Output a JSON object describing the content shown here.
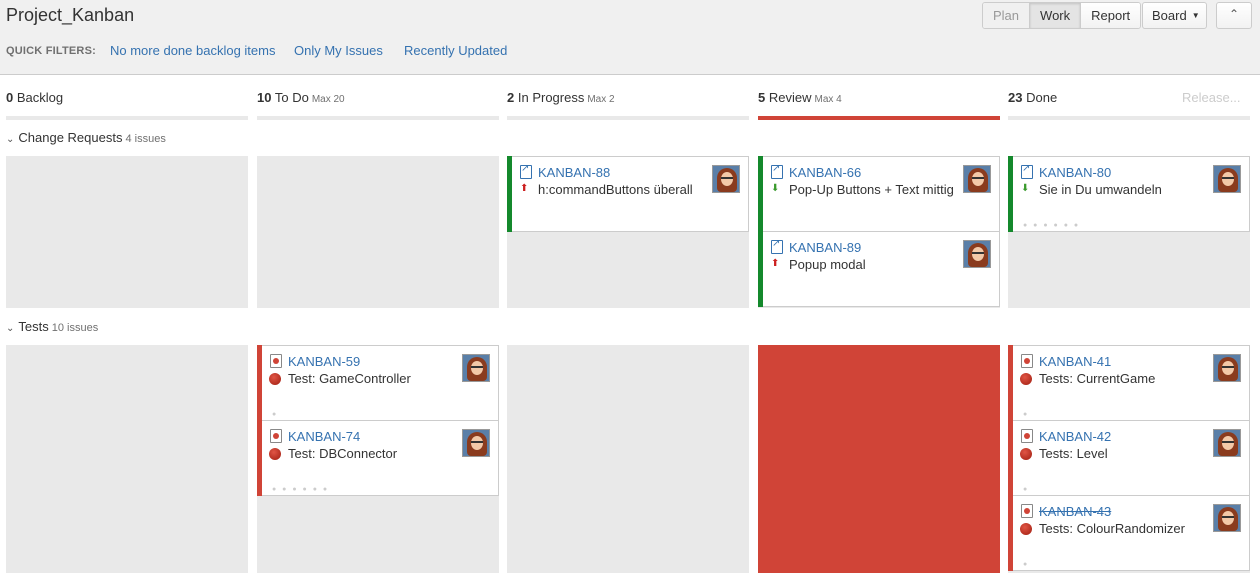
{
  "title": "Project_Kanban",
  "quick_filters": {
    "label": "QUICK FILTERS:",
    "items": [
      "No more done backlog items",
      "Only My Issues",
      "Recently Updated"
    ]
  },
  "modes": [
    "Plan",
    "Work",
    "Report"
  ],
  "board_button": "Board",
  "collapse_icon": "collapse-icon",
  "release_link": "Release...",
  "columns": [
    {
      "count": "0",
      "name": "Backlog",
      "max": ""
    },
    {
      "count": "10",
      "name": "To Do",
      "max": "Max 20"
    },
    {
      "count": "2",
      "name": "In Progress",
      "max": "Max 2"
    },
    {
      "count": "5",
      "name": "Review",
      "max": "Max 4"
    },
    {
      "count": "23",
      "name": "Done",
      "max": ""
    }
  ],
  "swimlanes": [
    {
      "name": "Change Requests",
      "count": "4 issues"
    },
    {
      "name": "Tests",
      "count": "10 issues"
    }
  ],
  "cards": [
    {
      "key": "KANBAN-88",
      "summary": "h:commandButtons überall"
    },
    {
      "key": "KANBAN-66",
      "summary": "Pop-Up Buttons + Text mittig"
    },
    {
      "key": "KANBAN-89",
      "summary": "Popup modal"
    },
    {
      "key": "KANBAN-80",
      "summary": "Sie in Du umwandeln"
    },
    {
      "key": "KANBAN-59",
      "summary": "Test: GameController"
    },
    {
      "key": "KANBAN-74",
      "summary": "Test: DBConnector"
    },
    {
      "key": "KANBAN-41",
      "summary": "Tests: CurrentGame"
    },
    {
      "key": "KANBAN-42",
      "summary": "Tests: Level"
    },
    {
      "key": "KANBAN-43",
      "summary": "Tests: ColourRandomizer"
    }
  ],
  "colors": {
    "accent": "#3572b0",
    "over_limit": "#d04437",
    "feature_stripe": "#14892c"
  }
}
